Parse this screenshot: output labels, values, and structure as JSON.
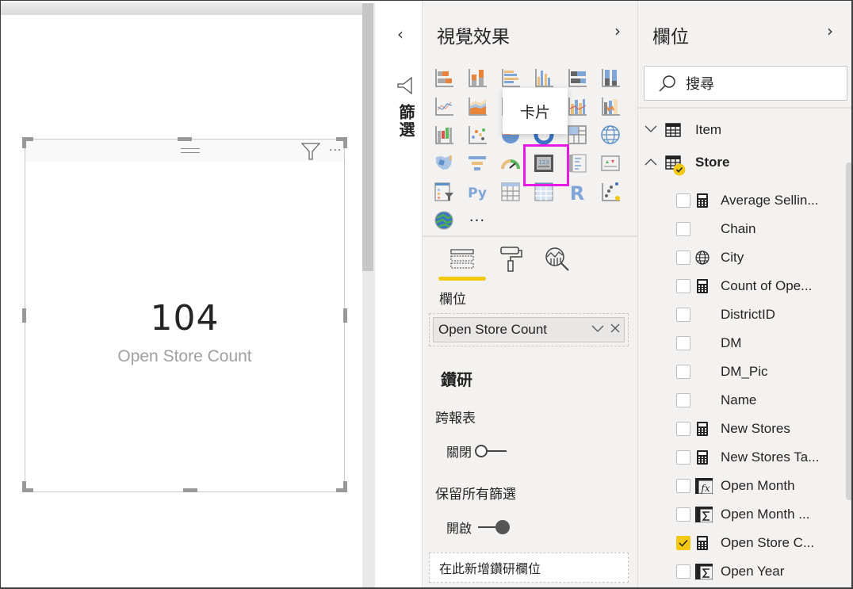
{
  "canvas": {
    "card": {
      "value": "104",
      "label": "Open Store Count",
      "more_label": "···"
    }
  },
  "filters_pane": {
    "label": "篩選",
    "collapse_glyph": "‹"
  },
  "visualizations_pane": {
    "title": "視覺效果",
    "expand_glyph": "›",
    "collapse_glyph": "‹",
    "tooltip": "卡片",
    "selected_visual": "card",
    "visuals": [
      "stacked-bar-chart",
      "stacked-column-chart",
      "clustered-bar-chart",
      "clustered-column-chart",
      "100-stacked-bar-chart",
      "100-stacked-column-chart",
      "line-chart",
      "area-chart",
      "stacked-area-chart",
      "line-clustered-column-chart",
      "line-stacked-column-chart",
      "ribbon-chart",
      "waterfall-chart",
      "scatter-chart",
      "pie-chart",
      "donut-chart",
      "treemap",
      "map",
      "filled-map",
      "funnel",
      "gauge",
      "card",
      "multi-row-card",
      "kpi",
      "slicer",
      "python-visual",
      "table",
      "matrix",
      "r-visual",
      "key-influencers",
      "arcgis-map",
      "more-visuals"
    ],
    "more_glyph": "···",
    "tabs": [
      "fields-tab",
      "format-tab",
      "analytics-tab"
    ],
    "active_tab": "fields-tab",
    "fields_section_label": "欄位",
    "fields_well_value": "Open Store Count",
    "drillthrough": {
      "title": "鑽研",
      "cross_report_label": "跨報表",
      "cross_report_state": "關閉",
      "cross_report_on": false,
      "keep_filters_label": "保留所有篩選",
      "keep_filters_state": "開啟",
      "keep_filters_on": true,
      "add_field_placeholder": "在此新增鑽研欄位"
    }
  },
  "fields_pane": {
    "title": "欄位",
    "expand_glyph": "›",
    "search_placeholder": "搜尋",
    "tables": [
      {
        "name": "Item",
        "expanded": false,
        "has_selection": false
      },
      {
        "name": "Store",
        "expanded": true,
        "has_selection": true
      }
    ],
    "store_fields": [
      {
        "name": "Average Sellin...",
        "icon": "calculator-icon",
        "checked": false
      },
      {
        "name": "Chain",
        "icon": "",
        "checked": false
      },
      {
        "name": "City",
        "icon": "globe-icon",
        "checked": false
      },
      {
        "name": "Count of Ope...",
        "icon": "calculator-icon",
        "checked": false
      },
      {
        "name": "DistrictID",
        "icon": "",
        "checked": false
      },
      {
        "name": "DM",
        "icon": "",
        "checked": false
      },
      {
        "name": "DM_Pic",
        "icon": "",
        "checked": false
      },
      {
        "name": "Name",
        "icon": "",
        "checked": false
      },
      {
        "name": "New Stores",
        "icon": "calculator-icon",
        "checked": false
      },
      {
        "name": "New Stores Ta...",
        "icon": "calculator-icon",
        "checked": false
      },
      {
        "name": "Open Month",
        "icon": "calculated-column-icon",
        "checked": false
      },
      {
        "name": "Open Month ...",
        "icon": "sum-column-icon",
        "checked": false
      },
      {
        "name": "Open Store C...",
        "icon": "calculator-icon",
        "checked": true
      },
      {
        "name": "Open Year",
        "icon": "sum-column-icon",
        "checked": false
      }
    ]
  },
  "colors": {
    "accent_yellow": "#f2c811",
    "selection_magenta": "#e619e6",
    "pane_background": "#f3f2f1",
    "text_primary": "#252423",
    "card_label_gray": "#a0a0a0"
  }
}
